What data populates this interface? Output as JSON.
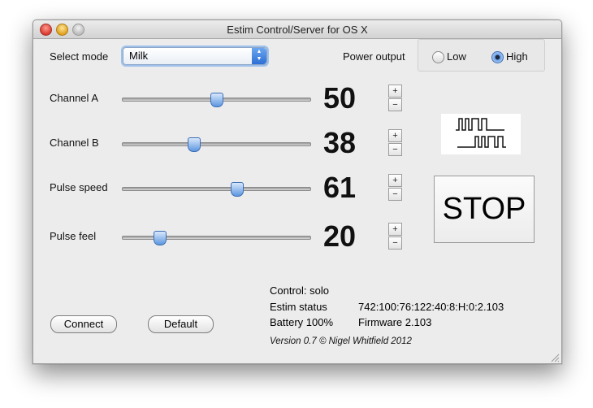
{
  "window": {
    "title": "Estim Control/Server for OS X"
  },
  "mode": {
    "label": "Select mode",
    "selected": "Milk"
  },
  "power": {
    "label": "Power output",
    "low_label": "Low",
    "high_label": "High",
    "selected": "High"
  },
  "channels": [
    {
      "label": "Channel A",
      "value": "50",
      "level": 50
    },
    {
      "label": "Channel B",
      "value": "38",
      "level": 38
    },
    {
      "label": "Pulse speed",
      "value": "61",
      "level": 61
    },
    {
      "label": "Pulse feel",
      "value": "20",
      "level": 20
    }
  ],
  "stepper": {
    "plus": "+",
    "minus": "−"
  },
  "stop_label": "STOP",
  "buttons": {
    "connect": "Connect",
    "default": "Default"
  },
  "status": {
    "control": "Control: solo",
    "estim_label": "Estim status",
    "estim_value": "742:100:76:122:40:8:H:0:2.103",
    "battery": "Battery 100%",
    "firmware": "Firmware 2.103",
    "version": "Version 0.7 © Nigel Whitfield 2012"
  },
  "icons": {
    "pulse": "pulse-waveform-icon"
  },
  "colors": {
    "accent": "#5d97e0",
    "window_bg": "#ececec"
  }
}
